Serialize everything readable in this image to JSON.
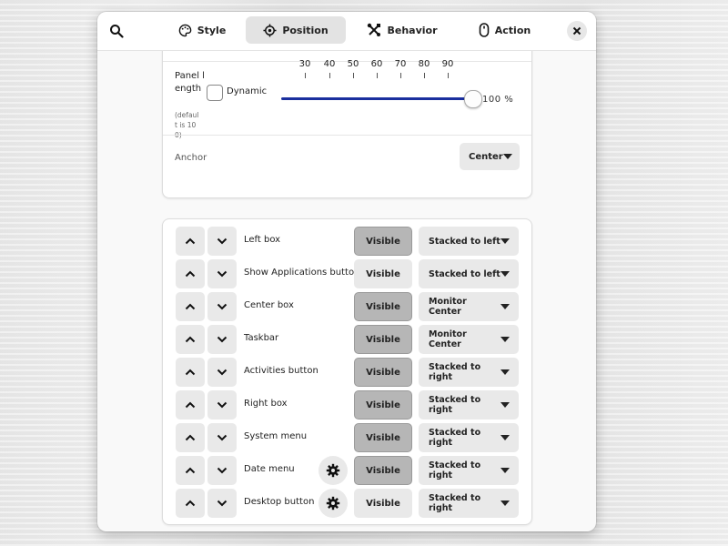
{
  "tabs": [
    {
      "label": "Style",
      "icon": "palette-icon"
    },
    {
      "label": "Position",
      "icon": "crosshair-icon",
      "active": true
    },
    {
      "label": "Behavior",
      "icon": "tools-icon"
    },
    {
      "label": "Action",
      "icon": "mouse-icon"
    }
  ],
  "panel_length": {
    "label": "Panel length",
    "note": "(default is 100)",
    "dynamic_label": "Dynamic",
    "dynamic_checked": false,
    "ticks": [
      "30",
      "40",
      "50",
      "60",
      "70",
      "80",
      "90"
    ],
    "value": 100,
    "value_text": "100 %",
    "accent_color": "#1a2f9e"
  },
  "anchor": {
    "label": "Anchor",
    "value": "Center"
  },
  "elements": [
    {
      "label": "Left box",
      "visible": true,
      "visibility_label": "Visible",
      "position": "Stacked to left",
      "has_settings": false
    },
    {
      "label": "Show Applications button",
      "visible": false,
      "visibility_label": "Visible",
      "position": "Stacked to left",
      "has_settings": false
    },
    {
      "label": "Center box",
      "visible": true,
      "visibility_label": "Visible",
      "position": "Monitor Center",
      "has_settings": false
    },
    {
      "label": "Taskbar",
      "visible": true,
      "visibility_label": "Visible",
      "position": "Monitor Center",
      "has_settings": false
    },
    {
      "label": "Activities button",
      "visible": true,
      "visibility_label": "Visible",
      "position": "Stacked to right",
      "has_settings": false
    },
    {
      "label": "Right box",
      "visible": true,
      "visibility_label": "Visible",
      "position": "Stacked to right",
      "has_settings": false
    },
    {
      "label": "System menu",
      "visible": true,
      "visibility_label": "Visible",
      "position": "Stacked to right",
      "has_settings": false
    },
    {
      "label": "Date menu",
      "visible": true,
      "visibility_label": "Visible",
      "position": "Stacked to right",
      "has_settings": true
    },
    {
      "label": "Desktop button",
      "visible": false,
      "visibility_label": "Visible",
      "position": "Stacked to right",
      "has_settings": true
    }
  ]
}
